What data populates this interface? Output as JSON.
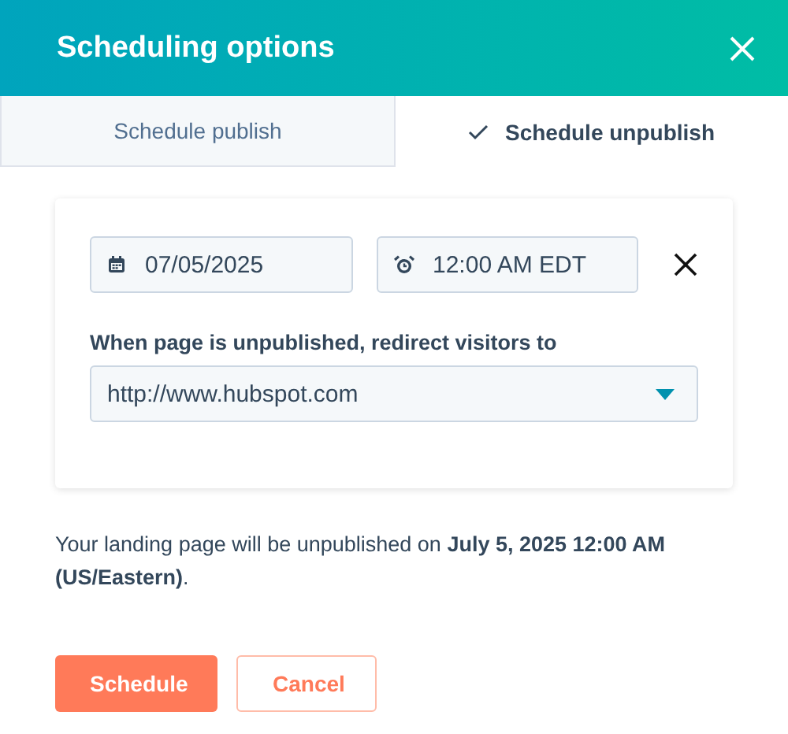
{
  "dialog": {
    "title": "Scheduling options"
  },
  "tabs": [
    {
      "label": "Schedule publish",
      "selected": false
    },
    {
      "label": "Schedule unpublish",
      "selected": true
    }
  ],
  "date_field": {
    "value": "07/05/2025"
  },
  "time_field": {
    "value": "12:00 AM EDT"
  },
  "redirect": {
    "label": "When page is unpublished, redirect visitors to",
    "value": "http://www.hubspot.com"
  },
  "summary": "Your landing page will be unpublished on **July 5, 2025 12:00 AM (US/Eastern)**.",
  "buttons": [
    {
      "label": "Schedule",
      "kind": "primary"
    },
    {
      "label": "Cancel",
      "kind": "secondary"
    }
  ]
}
